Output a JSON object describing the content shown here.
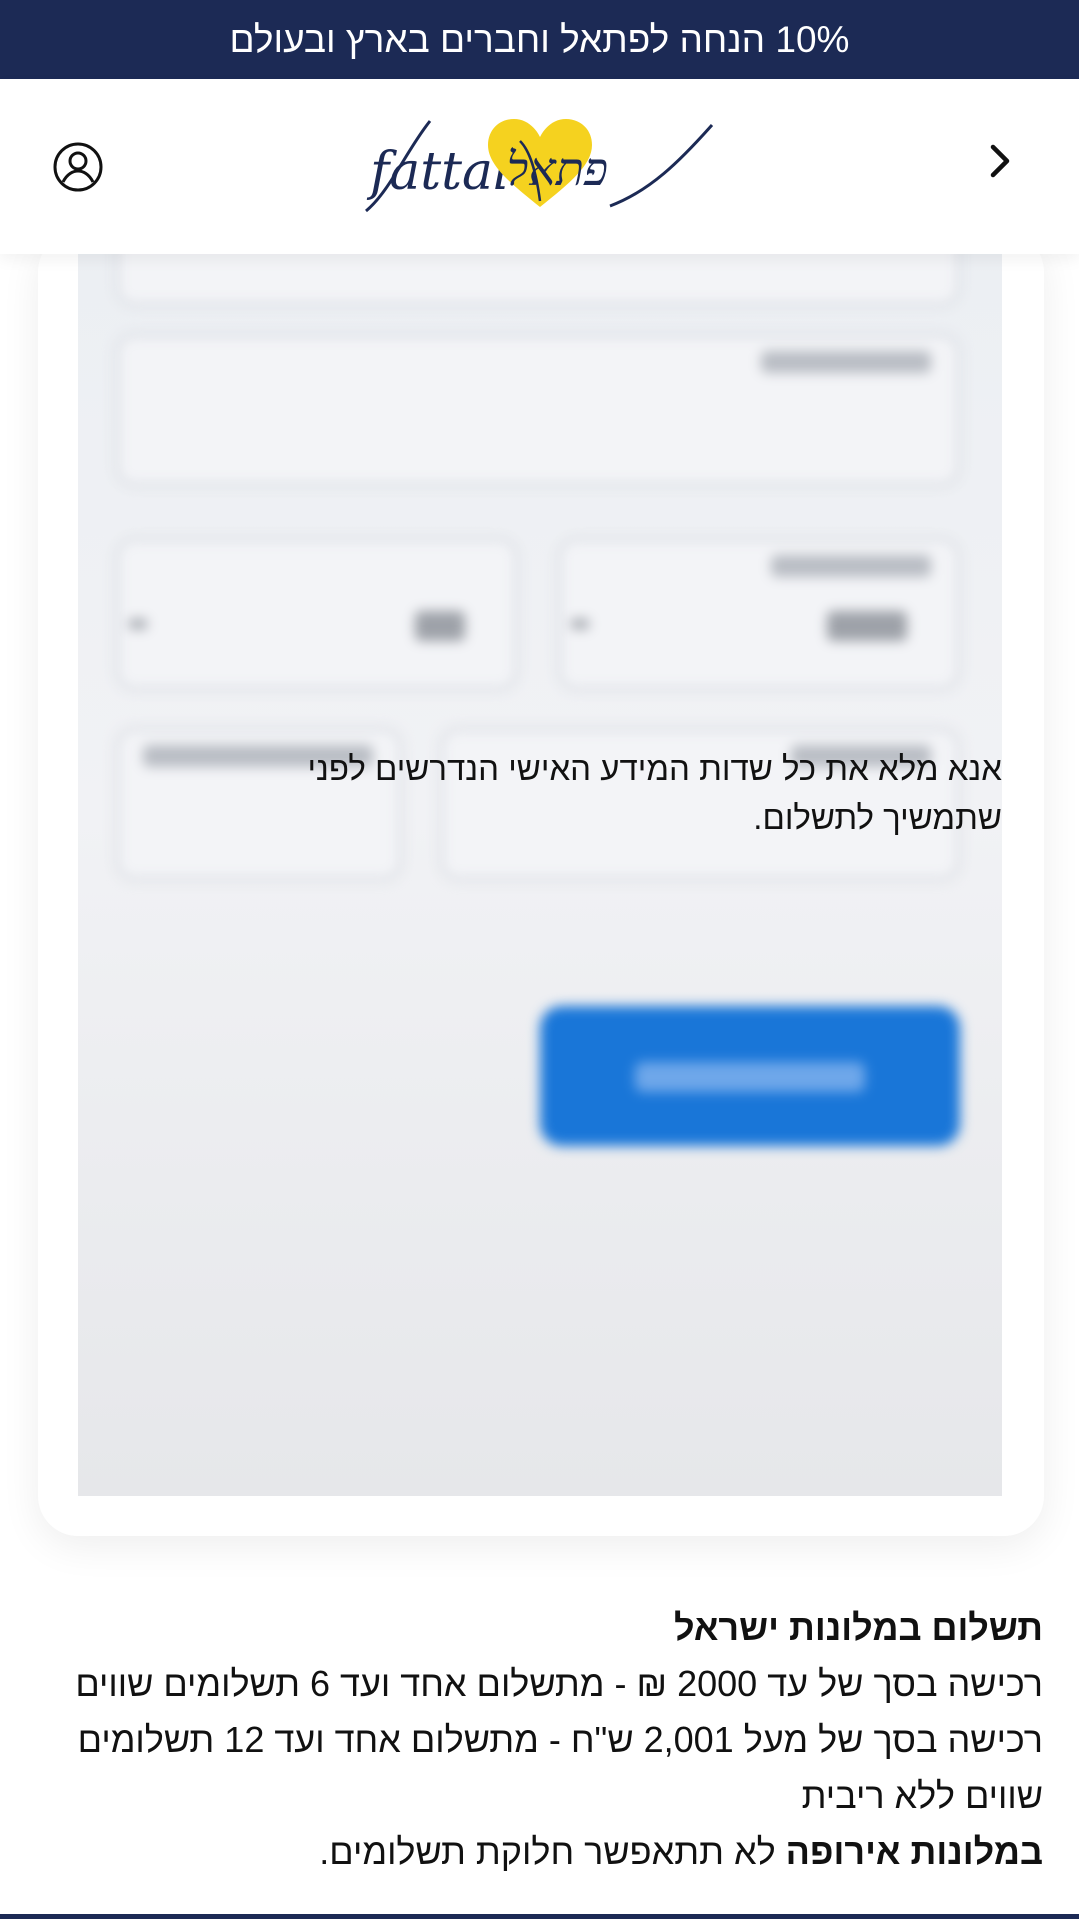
{
  "promo": {
    "text": "10% הנחה לפתאל וחברים בארץ ובעולם"
  },
  "header": {
    "logo_latin": "fattal",
    "logo_hebrew": "פתאל",
    "back_icon": "chevron-right-icon",
    "account_icon": "user-circle-icon",
    "colors": {
      "navy": "#1c2a55",
      "heart": "#f5d21f"
    }
  },
  "form": {
    "notice": "אנא מלא את כל שדות המידע האישי הנדרשים לפני שתמשיך לתשלום.",
    "button_color": "#1976d8"
  },
  "payment_info": {
    "title": "תשלום במלונות ישראל",
    "line1": "רכישה בסך של עד 2000 ₪ - מתשלום אחד ועד 6 תשלומים שווים",
    "line2": "רכישה בסך של מעל 2,001 ש\"ח  - מתשלום אחד ועד 12 תשלומים שווים ללא ריבית",
    "europe_bold": "במלונות אירופה",
    "europe_rest": " לא תתאפשר חלוקת תשלומים."
  }
}
